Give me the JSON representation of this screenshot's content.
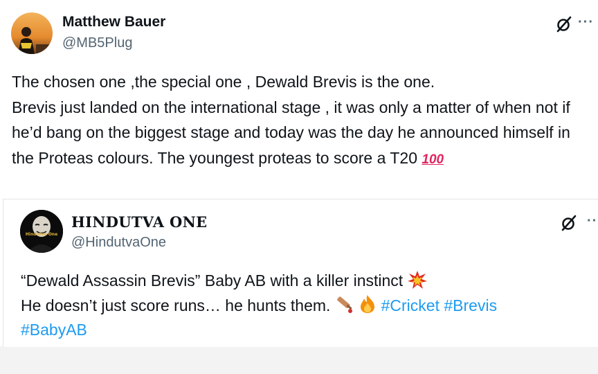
{
  "post": {
    "author_name": "Matthew Bauer",
    "author_handle": "@MB5Plug",
    "more_label": "···",
    "text_line1": "The chosen one ,the special one , Dewald Brevis is the one.",
    "text_line2": "Brevis just landed on the international stage , it was only a matter of when not if he’d bang on the biggest stage and today was the day he announced himself in the Proteas colours. The youngest proteas to score a T20",
    "emoji_100": "100"
  },
  "quote": {
    "author_name": "HINDUTVA ONE",
    "author_handle": "@HindutvaOne",
    "more_label": "··",
    "avatar_text": "Hindutva One",
    "text_line1": "“Dewald Assassin Brevis” Baby AB with a killer instinct",
    "text_line2_start": "He doesn’t just score runs… he hunts them.",
    "hashtags": [
      "#Cricket",
      "#Brevis",
      "#BabyAB"
    ]
  },
  "colors": {
    "hashtag": "#1d9bf0",
    "secondary_text": "#536471",
    "primary_text": "#0f1419",
    "emoji_100": "#e0245e"
  },
  "icons": [
    "grok-icon",
    "more-icon",
    "collision-emoji",
    "cricket-bat-emoji",
    "fire-emoji",
    "hundred-points-emoji"
  ]
}
